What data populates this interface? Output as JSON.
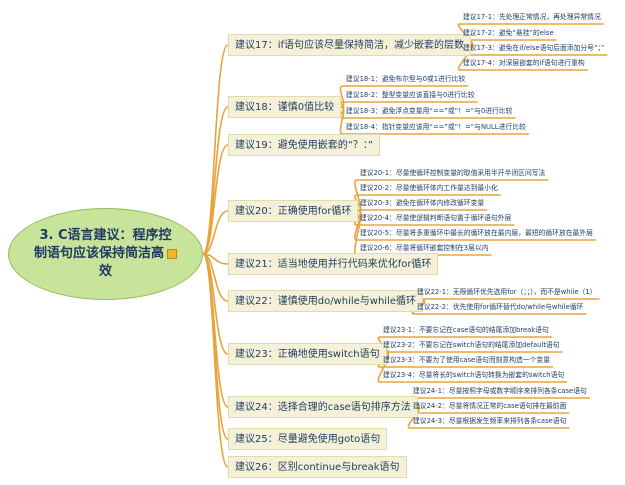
{
  "root": {
    "line1": "3. C语言建议：程序控",
    "line2": "制语句应该保持简洁高",
    "line3": "效"
  },
  "branches": [
    {
      "label": "建议17：if语句应该尽量保持简洁，减少嵌套的层数",
      "children": [
        "建议17-1：先处理正常情况，再处理异常情况",
        "建议17-2：避免“悬挂”的else",
        "建议17-3：避免在if/else语句后面添加分号“；”",
        "建议17-4：对深层嵌套的if语句进行重构"
      ]
    },
    {
      "label": "建议18：谨慎0值比较",
      "children": [
        "建议18-1：避免布尔型与0或1进行比较",
        "建议18-2：整型变量应该直接与0进行比较",
        "建议18-3：避免浮点变量用“==”或“！=”与0进行比较",
        "建议18-4：指针变量应该用“==”或“！=”与NULL进行比较"
      ]
    },
    {
      "label": "建议19：避免使用嵌套的“？：”",
      "children": []
    },
    {
      "label": "建议20：正确使用for循环",
      "children": [
        "建议20-1：尽量使循环控制变量的取值采用半开半闭区间写法",
        "建议20-2：尽量使循环体内工作量达到最小化",
        "建议20-3：避免在循环体内修改循环变量",
        "建议20-4：尽量使逻辑判断语句置于循环语句外层",
        "建议20-5：尽量将多重循环中最长的循环放在最内层，最短的循环放在最外层",
        "建议20-6：尽量将循环嵌套控制在3层以内"
      ]
    },
    {
      "label": "建议21：适当地使用并行代码来优化for循环",
      "children": []
    },
    {
      "label": "建议22：谨慎使用do/while与while循环",
      "children": [
        "建议22-1：无限循环优先选用for（；；），而不是while（1）",
        "建议22-2：优先使用for循环替代do/while与while循环"
      ]
    },
    {
      "label": "建议23：正确地使用switch语句",
      "children": [
        "建议23-1：不要忘记在case语句的结尾添加break语句",
        "建议23-2：不要忘记在switch语句的结尾添加default语句",
        "建议23-3：不要为了使用case语句而刻意构造一个变量",
        "建议23-4：尽量将长的switch语句转换为嵌套的switch语句"
      ]
    },
    {
      "label": "建议24：选择合理的case语句排序方法",
      "children": [
        "建议24-1：尽量按照字母或数字顺序来排列各条case语句",
        "建议24-2：尽量将情况正常的case语句排在最前面",
        "建议24-3：尽量根据发生频率来排列各条case语句"
      ]
    },
    {
      "label": "建议25：尽量避免使用goto语句",
      "children": []
    },
    {
      "label": "建议26：区别continue与break语句",
      "children": []
    }
  ],
  "colors": {
    "root_fill": "#c8e49a",
    "branch_fill": "#f5f1d8",
    "branch_border": "#e3dbb0",
    "connector": "#e8a33a",
    "text": "#1e3a5f"
  }
}
